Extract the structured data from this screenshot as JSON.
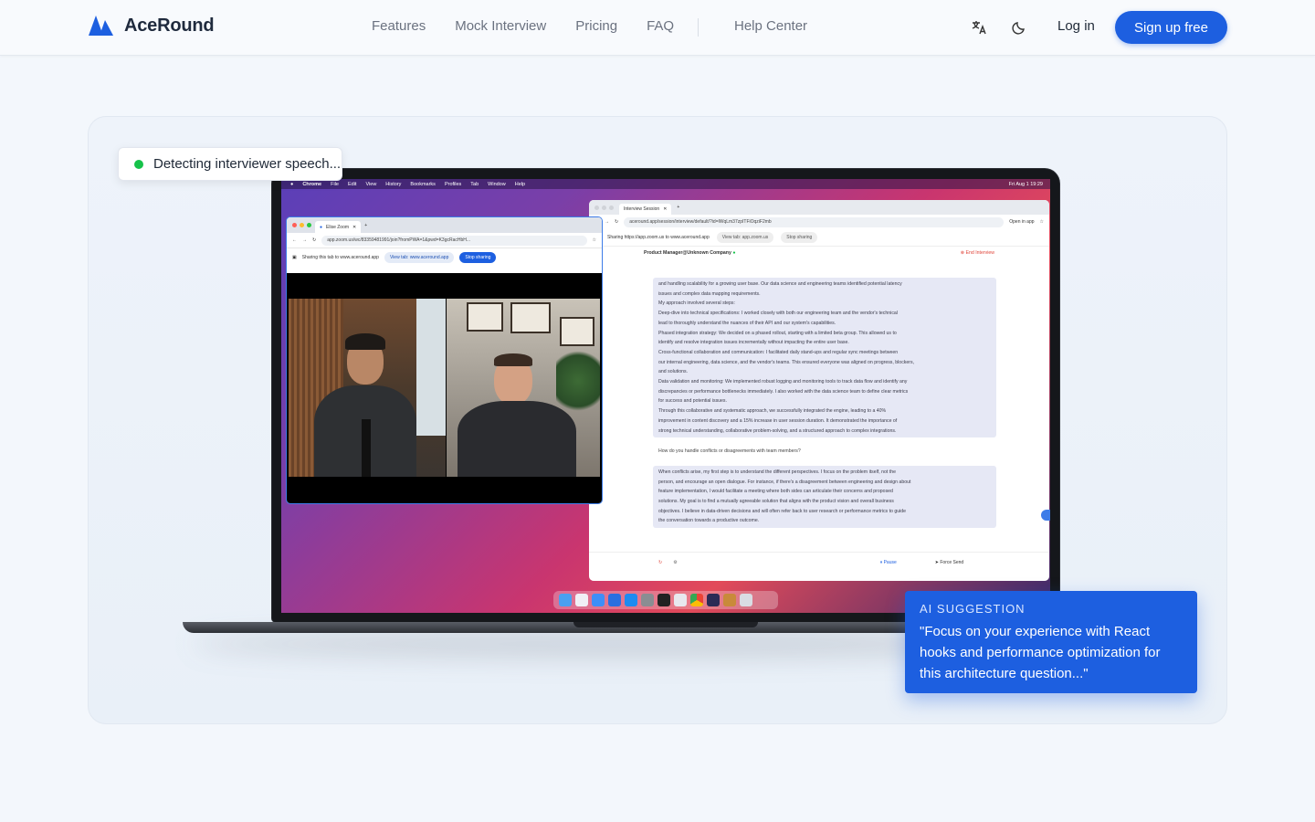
{
  "brand": {
    "name": "AceRound",
    "color": "#1d5fe0"
  },
  "nav": {
    "links": [
      "Features",
      "Mock Interview",
      "Pricing",
      "FAQ"
    ],
    "help": "Help Center",
    "login": "Log in",
    "signup": "Sign up free"
  },
  "detect_badge": {
    "text": "Detecting interviewer speech..."
  },
  "ai_card": {
    "label": "AI SUGGESTION",
    "text": "\"Focus on your experience with React hooks and performance optimization for this architecture question...\""
  },
  "mac_menubar": {
    "items": [
      "Chrome",
      "File",
      "Edit",
      "View",
      "History",
      "Bookmarks",
      "Profiles",
      "Tab",
      "Window",
      "Help"
    ],
    "clock": "Fri Aug 1 19:29"
  },
  "zoom_window": {
    "tab": "Elise Zoom",
    "url": "app.zoom.us/wc/83359481991/join?fromPWA=1&pwd=K3gcRacHbH...",
    "sharing": "Sharing this tab to www.aceround.app",
    "view_tab": "View tab: www.aceround.app",
    "stop": "Stop sharing"
  },
  "session_window": {
    "tab": "Interview Session",
    "url": "aceround.app/session/interview/default/?id=lWqLm37zpITFiOqziF2mb",
    "open_in_app": "Open in app",
    "sharing": "Sharing https://app.zoom.us to www.aceround.app",
    "view_tab": "View tab: app.zoom.us",
    "stop": "Stop sharing",
    "role": "Product Manager@Unknown Company",
    "end": "End Interview",
    "lines": [
      "and handling scalability for a growing user base. Our data science and engineering teams identified potential latency",
      "issues and complex data mapping requirements.",
      "My approach involved several steps:",
      "Deep-dive into technical specifications: I worked closely with both our engineering team and the vendor's technical",
      "lead to thoroughly understand the nuances of their API and our system's capabilities.",
      "Phased integration strategy: We decided on a phased rollout, starting with a limited beta group. This allowed us to",
      "identify and resolve integration issues incrementally without impacting the entire user base.",
      "Cross-functional collaboration and communication: I facilitated daily stand-ups and regular sync meetings between",
      "our internal engineering, data science, and the vendor's teams. This ensured everyone was aligned on progress, blockers,",
      "and solutions.",
      "Data validation and monitoring: We implemented robust logging and monitoring tools to track data flow and identify any",
      "discrepancies or performance bottlenecks immediately. I also worked with the data science team to define clear metrics",
      "for success and potential issues.",
      "Through this collaborative and systematic approach, we successfully integrated the engine, leading to a 40%",
      "improvement in content discovery and a 15% increase in user session duration. It demonstrated the importance of",
      "strong technical understanding, collaborative problem-solving, and a structured approach to complex integrations."
    ],
    "question": "How do you handle conflicts or disagreements with team members?",
    "answer_lines": [
      "When conflicts arise, my first step is to understand the different perspectives. I focus on the problem itself, not the",
      "person, and encourage an open dialogue. For instance, if there's a disagreement between engineering and design about",
      "feature implementation, I would facilitate a meeting where both sides can articulate their concerns and proposed",
      "solutions. My goal is to find a mutually agreeable solution that aligns with the product vision and overall business",
      "objectives. I believe in data-driven decisions and will often refer back to user research or performance metrics to guide",
      "the conversation towards a productive outcome."
    ],
    "pause": "Pause",
    "force_send": "Force Send"
  }
}
